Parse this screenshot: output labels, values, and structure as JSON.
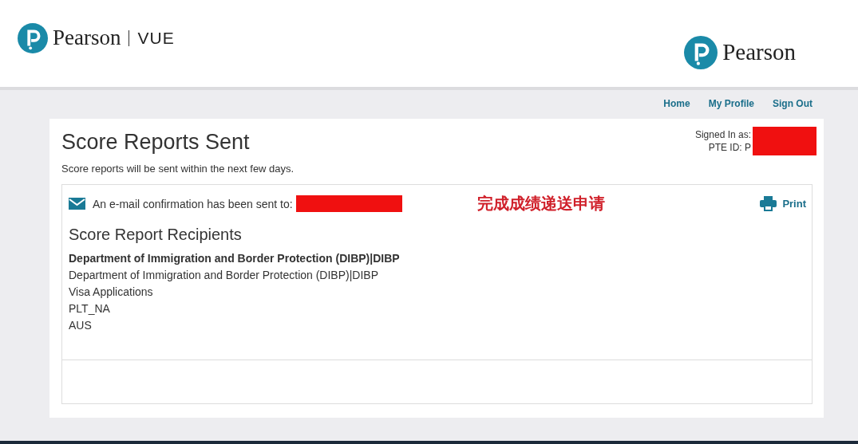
{
  "header": {
    "left_logo": {
      "brand": "Pearson",
      "product": "VUE"
    },
    "right_logo": {
      "brand": "Pearson"
    }
  },
  "nav": [
    "Home",
    "My Profile",
    "Sign Out"
  ],
  "page": {
    "title": "Score Reports Sent",
    "subtitle": "Score reports will be sent within the next few days.",
    "signed_in_label": "Signed In as:",
    "pte_id_label": "PTE ID: P"
  },
  "confirmation": {
    "text": "An e-mail confirmation has been sent to:",
    "annotation": "完成成绩递送申请",
    "print": "Print"
  },
  "recipients": {
    "heading": "Score Report Recipients",
    "lines": [
      {
        "text": "Department of Immigration and Border Protection (DIBP)|DIBP",
        "bold": true
      },
      {
        "text": "Department of Immigration and Border Protection (DIBP)|DIBP",
        "bold": false
      },
      {
        "text": "Visa Applications",
        "bold": false
      },
      {
        "text": "PLT_NA",
        "bold": false
      },
      {
        "text": "AUS",
        "bold": false
      }
    ]
  }
}
